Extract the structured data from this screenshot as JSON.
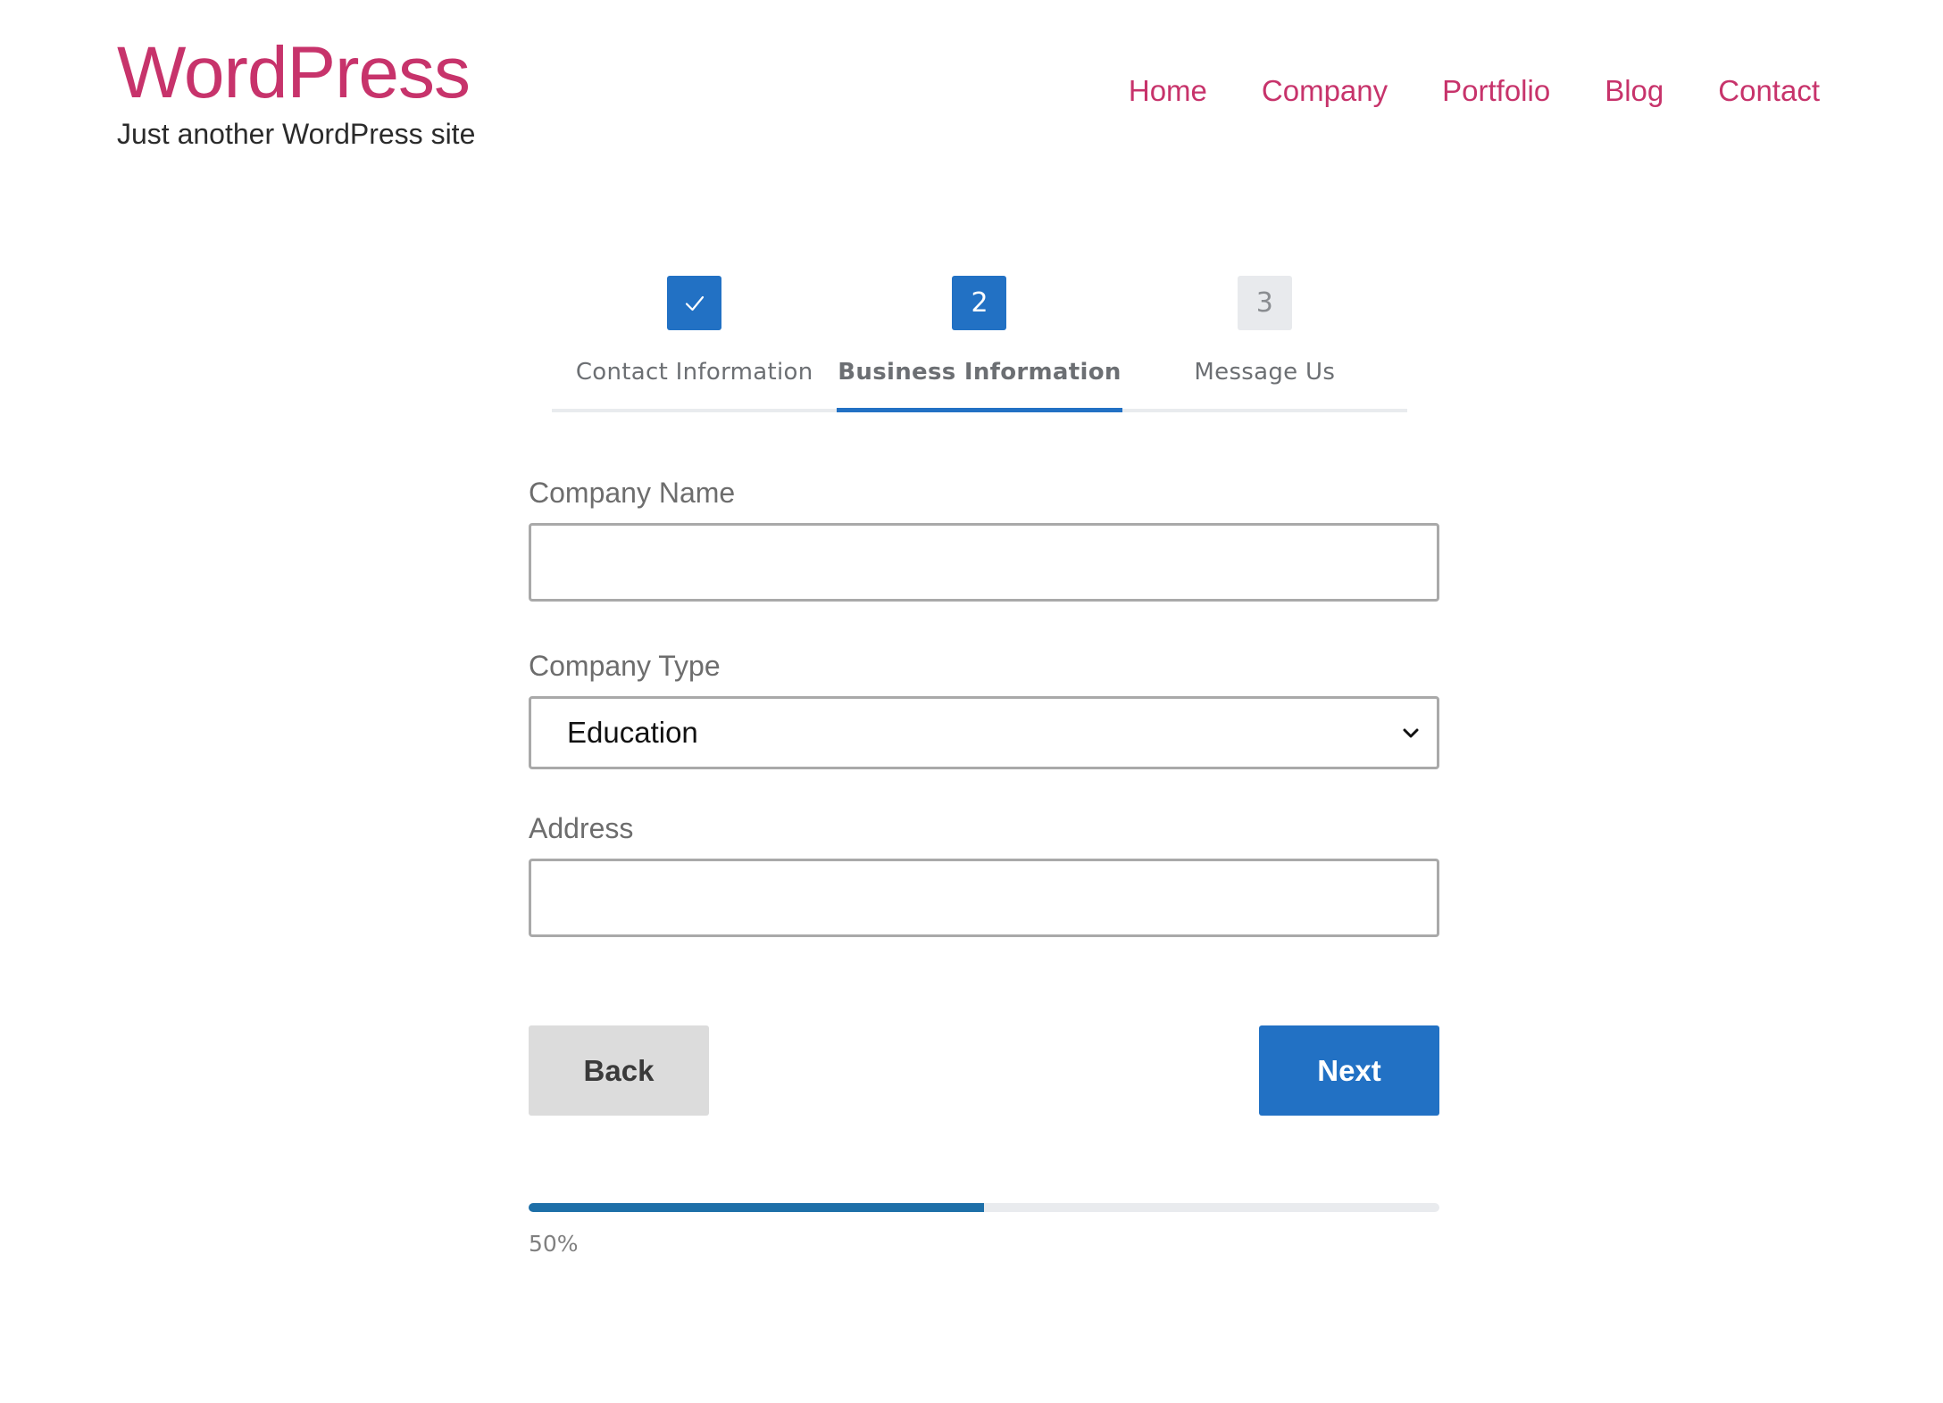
{
  "site": {
    "title": "WordPress",
    "tagline": "Just another WordPress site",
    "accent_color": "#c7336b"
  },
  "nav": {
    "items": [
      {
        "label": "Home"
      },
      {
        "label": "Company"
      },
      {
        "label": "Portfolio"
      },
      {
        "label": "Blog"
      },
      {
        "label": "Contact"
      }
    ]
  },
  "steps": {
    "items": [
      {
        "badge": "✓",
        "label": "Contact Information",
        "state": "completed",
        "icon": "checkmark-icon"
      },
      {
        "badge": "2",
        "label": "Business Information",
        "state": "active"
      },
      {
        "badge": "3",
        "label": "Message Us",
        "state": "pending"
      }
    ],
    "active_color": "#2271c4"
  },
  "form": {
    "company_name": {
      "label": "Company Name",
      "value": "",
      "placeholder": ""
    },
    "company_type": {
      "label": "Company Type",
      "selected": "Education",
      "icon": "chevron-down-icon"
    },
    "address": {
      "label": "Address",
      "value": "",
      "placeholder": ""
    },
    "back_label": "Back",
    "next_label": "Next"
  },
  "progress": {
    "percent": 50,
    "text": "50%",
    "fill_color": "#1d6fa8"
  }
}
